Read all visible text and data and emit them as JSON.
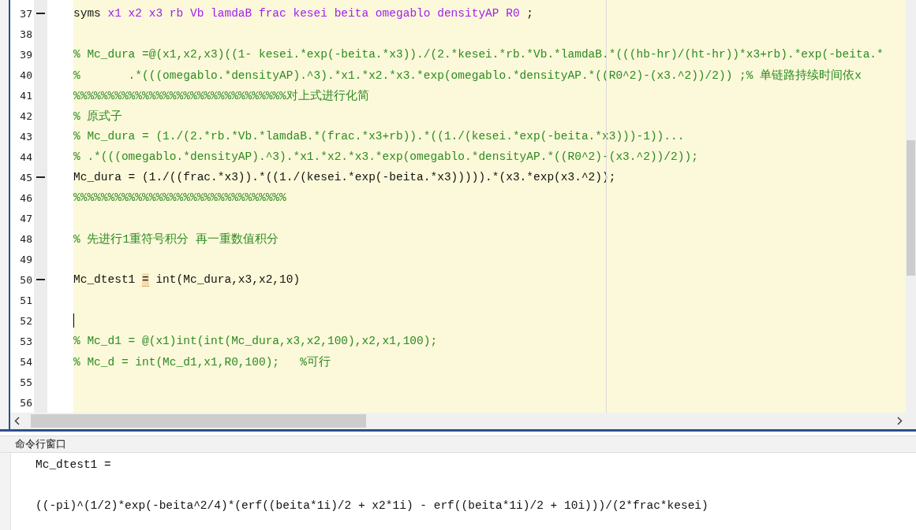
{
  "editor": {
    "lines": [
      {
        "number": "37",
        "dash": true,
        "cursor": false,
        "kind": "syms",
        "keyword": "syms",
        "args": "x1 x2 x3 rb Vb lamdaB frac kesei beita omegablo densityAP R0",
        "tail": " ;"
      },
      {
        "number": "38",
        "dash": false,
        "cursor": false,
        "kind": "code"
      },
      {
        "number": "39",
        "dash": false,
        "cursor": false,
        "kind": "comment",
        "text": "% Mc_dura =@(x1,x2,x3)((1- kesei.*exp(-beita.*x3))./(2.*kesei.*rb.*Vb.*lamdaB.*(((hb-hr)/(ht-hr))*x3+rb).*exp(-beita.*"
      },
      {
        "number": "40",
        "dash": false,
        "cursor": false,
        "kind": "comment",
        "text": "%       .*(((omegablo.*densityAP).^3).*x1.*x2.*x3.*exp(omegablo.*densityAP.*((R0^2)-(x3.^2))/2)) ;% 单链路持续时间依x"
      },
      {
        "number": "41",
        "dash": false,
        "cursor": false,
        "kind": "comment",
        "text": "%%%%%%%%%%%%%%%%%%%%%%%%%%%%%%%对上式进行化简"
      },
      {
        "number": "42",
        "dash": false,
        "cursor": false,
        "kind": "comment",
        "text": "% 原式子"
      },
      {
        "number": "43",
        "dash": false,
        "cursor": false,
        "kind": "comment",
        "text": "% Mc_dura = (1./(2.*rb.*Vb.*lamdaB.*(frac.*x3+rb)).*((1./(kesei.*exp(-beita.*x3)))-1))..."
      },
      {
        "number": "44",
        "dash": false,
        "cursor": false,
        "kind": "comment",
        "text": "% .*(((omegablo.*densityAP).^3).*x1.*x2.*x3.*exp(omegablo.*densityAP.*((R0^2)-(x3.^2))/2));"
      },
      {
        "number": "45",
        "dash": true,
        "cursor": false,
        "kind": "code",
        "text": "Mc_dura = (1./((frac.*x3)).*((1./(kesei.*exp(-beita.*x3))))).*(x3.*exp(x3.^2));"
      },
      {
        "number": "46",
        "dash": false,
        "cursor": false,
        "kind": "comment",
        "text": "%%%%%%%%%%%%%%%%%%%%%%%%%%%%%%%"
      },
      {
        "number": "47",
        "dash": false,
        "cursor": false,
        "kind": "code"
      },
      {
        "number": "48",
        "dash": false,
        "cursor": false,
        "kind": "comment",
        "text": "% 先进行1重符号积分 再一重数值积分"
      },
      {
        "number": "49",
        "dash": false,
        "cursor": false,
        "kind": "code"
      },
      {
        "number": "50",
        "dash": true,
        "cursor": false,
        "kind": "warned",
        "before": "Mc_dtest1 ",
        "marked": "=",
        "after": " int(Mc_dura,x3,x2,10)"
      },
      {
        "number": "51",
        "dash": false,
        "cursor": false,
        "kind": "code"
      },
      {
        "number": "52",
        "dash": false,
        "cursor": true,
        "kind": "code"
      },
      {
        "number": "53",
        "dash": false,
        "cursor": false,
        "kind": "comment",
        "text": "% Mc_d1 = @(x1)int(int(Mc_dura,x3,x2,100),x2,x1,100);"
      },
      {
        "number": "54",
        "dash": false,
        "cursor": false,
        "kind": "comment",
        "text": "% Mc_d = int(Mc_d1,x1,R0,100);   %可行"
      },
      {
        "number": "55",
        "dash": false,
        "cursor": false,
        "kind": "code"
      },
      {
        "number": "56",
        "dash": false,
        "cursor": false,
        "kind": "code"
      }
    ]
  },
  "command_window": {
    "title": "命令行窗口",
    "output": [
      "Mc_dtest1 =",
      "((-pi)^(1/2)*exp(-beita^2/4)*(erf((beita*1i)/2 + x2*1i) - erf((beita*1i)/2 + 10i)))/(2*frac*kesei)"
    ]
  }
}
